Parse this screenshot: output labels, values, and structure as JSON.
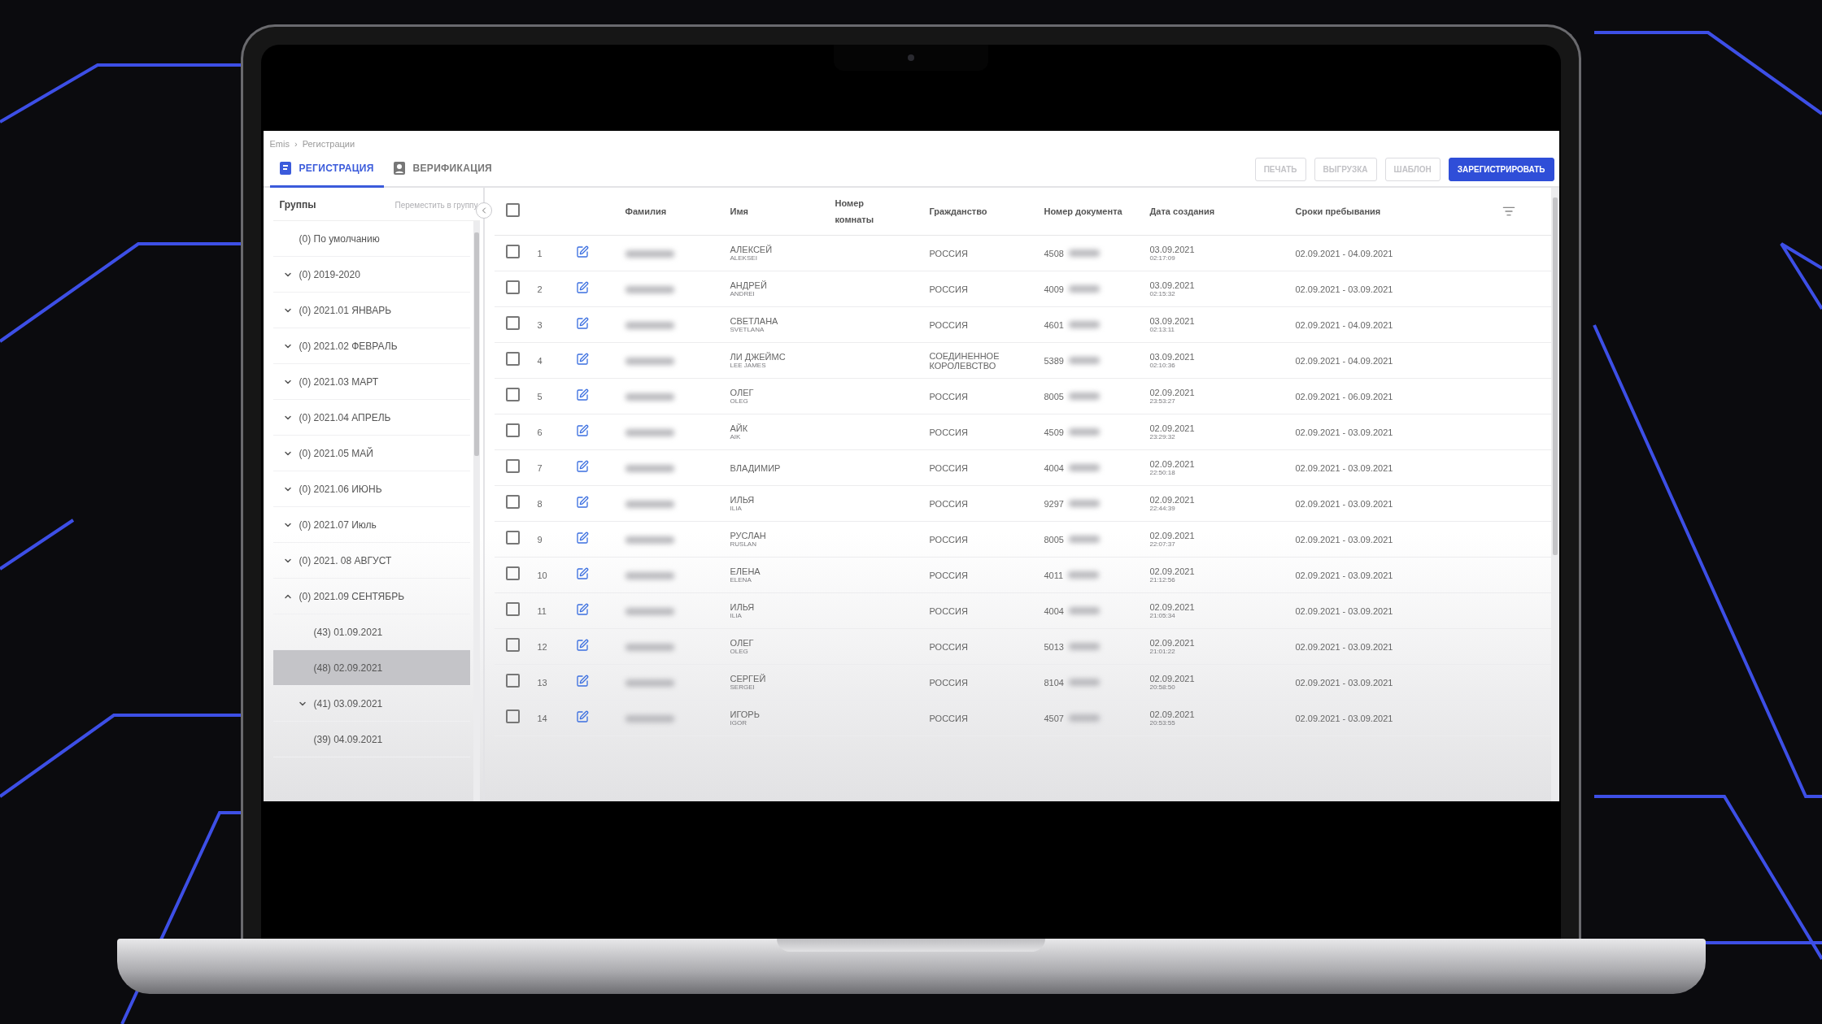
{
  "breadcrumbs": {
    "items": [
      "Emis",
      "Регистрации"
    ],
    "separator": "›"
  },
  "tabs": [
    {
      "label": "РЕГИСТРАЦИЯ",
      "selected": true,
      "kind": "document"
    },
    {
      "label": "ВЕРИФИКАЦИЯ",
      "selected": false,
      "kind": "person"
    }
  ],
  "buttons": [
    {
      "label": "ПЕЧАТЬ",
      "kind": "outlined",
      "disabled": true
    },
    {
      "label": "ВЫГРУЗКА",
      "kind": "outlined",
      "disabled": true
    },
    {
      "label": "ШАБЛОН",
      "kind": "outlined",
      "disabled": true
    },
    {
      "label": "ЗАРЕГИСТРИРОВАТЬ",
      "kind": "primary",
      "disabled": false
    }
  ],
  "sidebar": {
    "title": "Группы",
    "action": "Переместить в группу",
    "groups": [
      {
        "label": "(0) По умолчанию",
        "selected": false
      },
      {
        "label": "(0) 2019-2020",
        "selected": false,
        "expanded": false
      },
      {
        "label": "(0) 2021.01 ЯНВАРЬ",
        "selected": false,
        "expanded": false
      },
      {
        "label": "(0) 2021.02 ФЕВРАЛЬ",
        "selected": false,
        "expanded": false
      },
      {
        "label": "(0) 2021.03 МАРТ",
        "selected": false,
        "expanded": false
      },
      {
        "label": "(0) 2021.04 АПРЕЛЬ",
        "selected": false,
        "expanded": false
      },
      {
        "label": "(0) 2021.05 МАЙ",
        "selected": false,
        "expanded": false
      },
      {
        "label": "(0) 2021.06 ИЮНЬ",
        "selected": false,
        "expanded": false
      },
      {
        "label": "(0) 2021.07 Июль",
        "selected": false,
        "expanded": false
      },
      {
        "label": "(0) 2021. 08 АВГУСТ",
        "selected": false,
        "expanded": false
      },
      {
        "label": "(0) 2021.09 СЕНТЯБРЬ",
        "selected": false,
        "expanded": true,
        "children": [
          {
            "label": "(43) 01.09.2021",
            "selected": false
          },
          {
            "label": "(48) 02.09.2021",
            "selected": true
          },
          {
            "label": "(41) 03.09.2021",
            "selected": false,
            "expanded": false
          },
          {
            "label": "(39) 04.09.2021",
            "selected": false
          }
        ]
      }
    ]
  },
  "table": {
    "select_all": {
      "checked": false
    },
    "columns": [
      "Фамилия",
      "Имя",
      "Номер комнаты",
      "Гражданство",
      "Номер документа",
      "Дата создания",
      "Сроки пребывания"
    ],
    "rows": [
      {
        "num": "1",
        "checked": false,
        "name": "АЛЕКСЕЙ",
        "name_latin": "ALEKSEI",
        "citizenship": "РОССИЯ",
        "doc_number": "4508",
        "created_date": "03.09.2021",
        "created_time": "02:17:09",
        "stay": "02.09.2021 - 04.09.2021"
      },
      {
        "num": "2",
        "checked": false,
        "name": "АНДРЕЙ",
        "name_latin": "ANDREI",
        "citizenship": "РОССИЯ",
        "doc_number": "4009",
        "created_date": "03.09.2021",
        "created_time": "02:15:32",
        "stay": "02.09.2021 - 03.09.2021"
      },
      {
        "num": "3",
        "checked": false,
        "name": "СВЕТЛАНА",
        "name_latin": "SVETLANA",
        "citizenship": "РОССИЯ",
        "doc_number": "4601",
        "created_date": "03.09.2021",
        "created_time": "02:13:11",
        "stay": "02.09.2021 - 04.09.2021"
      },
      {
        "num": "4",
        "checked": false,
        "name": "ЛИ ДЖЕЙМС",
        "name_latin": "LEE JAMES",
        "citizenship": "СОЕДИНЕННОЕ КОРОЛЕВСТВО",
        "doc_number": "5389",
        "created_date": "03.09.2021",
        "created_time": "02:10:36",
        "stay": "02.09.2021 - 04.09.2021"
      },
      {
        "num": "5",
        "checked": false,
        "name": "ОЛЕГ",
        "name_latin": "OLEG",
        "citizenship": "РОССИЯ",
        "doc_number": "8005",
        "created_date": "02.09.2021",
        "created_time": "23:53:27",
        "stay": "02.09.2021 - 06.09.2021"
      },
      {
        "num": "6",
        "checked": false,
        "name": "АЙК",
        "name_latin": "AIK",
        "citizenship": "РОССИЯ",
        "doc_number": "4509",
        "created_date": "02.09.2021",
        "created_time": "23:29:32",
        "stay": "02.09.2021 - 03.09.2021"
      },
      {
        "num": "7",
        "checked": false,
        "name": "ВЛАДИМИР",
        "citizenship": "РОССИЯ",
        "doc_number": "4004",
        "created_date": "02.09.2021",
        "created_time": "22:50:18",
        "stay": "02.09.2021 - 03.09.2021"
      },
      {
        "num": "8",
        "checked": false,
        "name": "ИЛЬЯ",
        "name_latin": "ILIA",
        "citizenship": "РОССИЯ",
        "doc_number": "9297",
        "created_date": "02.09.2021",
        "created_time": "22:44:39",
        "stay": "02.09.2021 - 03.09.2021"
      },
      {
        "num": "9",
        "checked": false,
        "name": "РУСЛАН",
        "name_latin": "RUSLAN",
        "citizenship": "РОССИЯ",
        "doc_number": "8005",
        "created_date": "02.09.2021",
        "created_time": "22:07:37",
        "stay": "02.09.2021 - 03.09.2021"
      },
      {
        "num": "10",
        "checked": false,
        "name": "ЕЛЕНА",
        "name_latin": "ELENA",
        "citizenship": "РОССИЯ",
        "doc_number": "4011",
        "created_date": "02.09.2021",
        "created_time": "21:12:56",
        "stay": "02.09.2021 - 03.09.2021"
      },
      {
        "num": "11",
        "checked": false,
        "name": "ИЛЬЯ",
        "name_latin": "ILIA",
        "citizenship": "РОССИЯ",
        "doc_number": "4004",
        "created_date": "02.09.2021",
        "created_time": "21:05:34",
        "stay": "02.09.2021 - 03.09.2021"
      },
      {
        "num": "12",
        "checked": false,
        "name": "ОЛЕГ",
        "name_latin": "OLEG",
        "citizenship": "РОССИЯ",
        "doc_number": "5013",
        "created_date": "02.09.2021",
        "created_time": "21:01:22",
        "stay": "02.09.2021 - 03.09.2021"
      },
      {
        "num": "13",
        "checked": false,
        "name": "СЕРГЕЙ",
        "name_latin": "SERGEI",
        "citizenship": "РОССИЯ",
        "doc_number": "8104",
        "created_date": "02.09.2021",
        "created_time": "20:58:50",
        "stay": "02.09.2021 - 03.09.2021"
      },
      {
        "num": "14",
        "checked": false,
        "name": "ИГОРЬ",
        "name_latin": "IGOR",
        "citizenship": "РОССИЯ",
        "doc_number": "4507",
        "created_date": "02.09.2021",
        "created_time": "20:53:55",
        "stay": "02.09.2021 - 03.09.2021"
      }
    ]
  }
}
